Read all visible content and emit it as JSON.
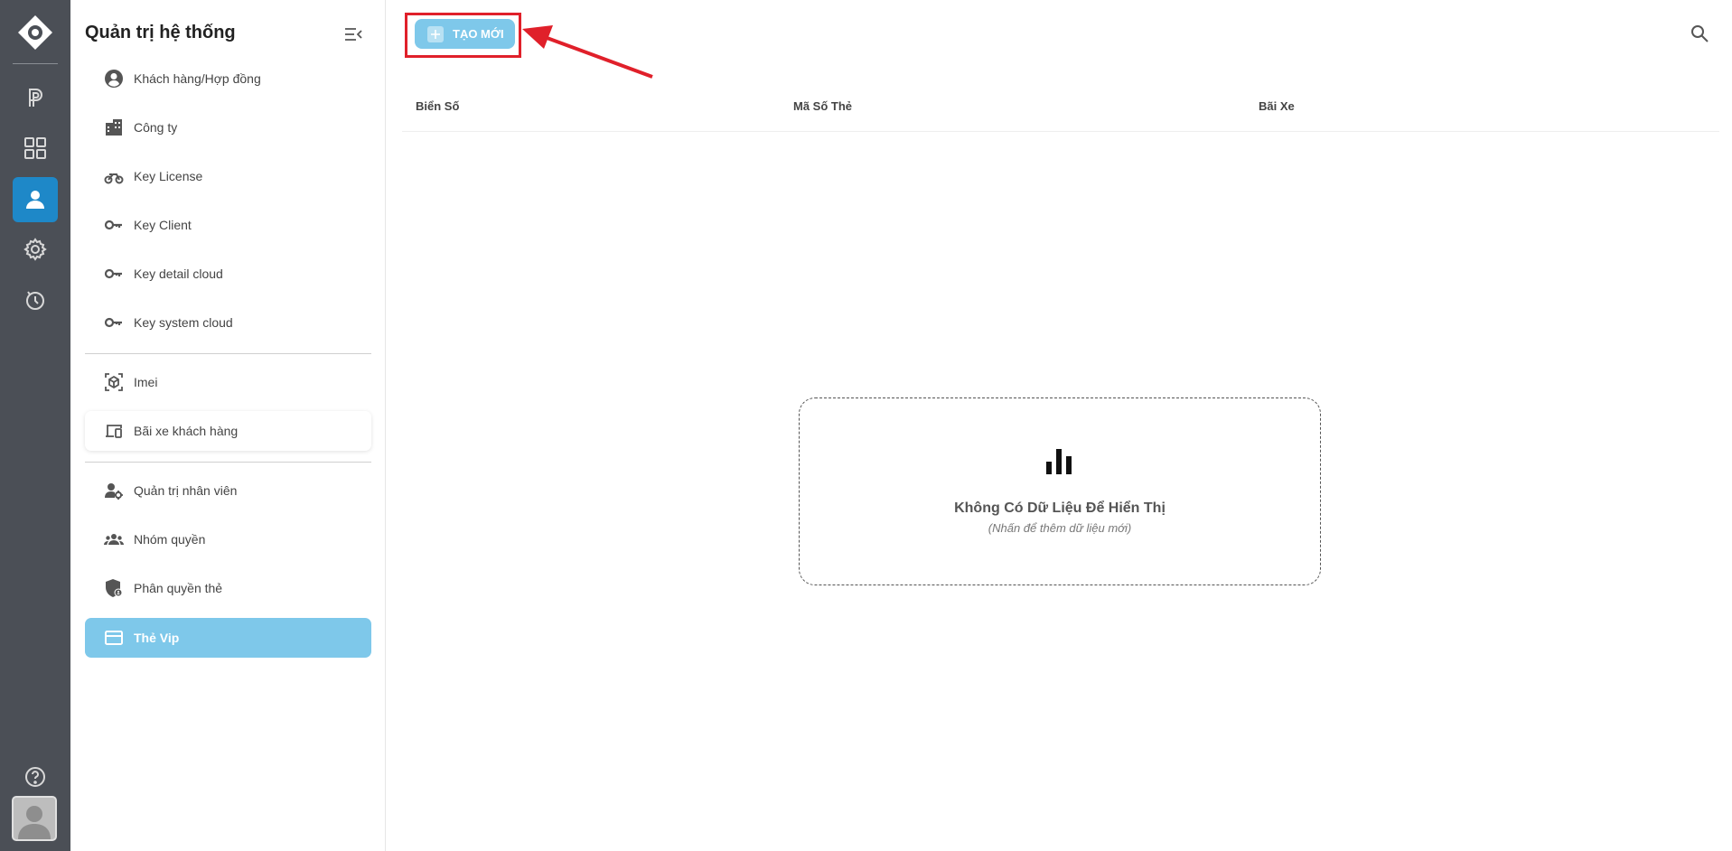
{
  "sidebar": {
    "title": "Quản trị hệ thống",
    "items": [
      {
        "label": "Khách hàng/Hợp đồng",
        "icon": "account-circle-icon"
      },
      {
        "label": "Công ty",
        "icon": "building-icon"
      },
      {
        "label": "Key License",
        "icon": "motorbike-icon"
      },
      {
        "label": "Key Client",
        "icon": "key-icon"
      },
      {
        "label": "Key detail cloud",
        "icon": "key-icon"
      },
      {
        "label": "Key system cloud",
        "icon": "key-icon"
      },
      {
        "label": "Imei",
        "icon": "scan-cube-icon"
      },
      {
        "label": "Bãi xe khách hàng",
        "icon": "devices-icon"
      },
      {
        "label": "Quản trị nhân viên",
        "icon": "user-cog-icon"
      },
      {
        "label": "Nhóm quyền",
        "icon": "group-icon"
      },
      {
        "label": "Phân quyền thẻ",
        "icon": "shield-icon"
      },
      {
        "label": "Thẻ Vip",
        "icon": "credit-card-icon",
        "active": true
      }
    ]
  },
  "toolbar": {
    "create_label": "TẠO MỚI"
  },
  "table": {
    "columns": [
      "Biển Số",
      "Mã Số Thẻ",
      "Bãi Xe"
    ]
  },
  "empty_state": {
    "title": "Không Có Dữ Liệu Để Hiển Thị",
    "subtitle": "(Nhấn để thêm dữ liệu mới)"
  },
  "colors": {
    "rail": "#4b4f56",
    "rail_active": "#1e88c8",
    "accent": "#7ec8ea",
    "highlight": "#e0202a"
  }
}
